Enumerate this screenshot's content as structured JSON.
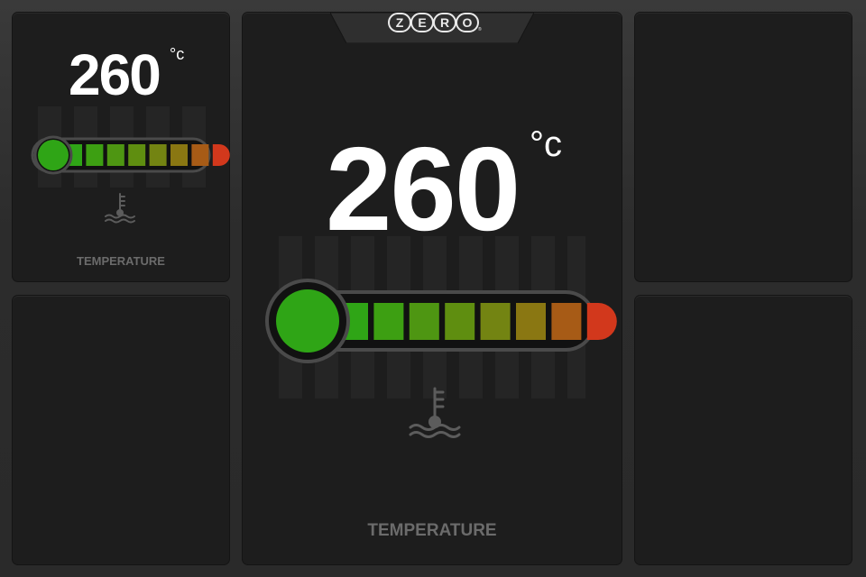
{
  "brand": {
    "letters": [
      "Z",
      "E",
      "R",
      "O"
    ],
    "mark": "®"
  },
  "gauges": {
    "small": {
      "value": "260",
      "unit": "°c",
      "label": "TEMPERATURE",
      "level": 1.0
    },
    "large": {
      "value": "260",
      "unit": "°c",
      "label": "TEMPERATURE",
      "level": 1.0
    }
  },
  "colors": {
    "segments": [
      "#2fa516",
      "#3d9f12",
      "#4e9612",
      "#5f8e10",
      "#738412",
      "#8a7712",
      "#a75b16",
      "#d2381c"
    ],
    "bulb": "#2fa516",
    "panel": "#1d1d1d",
    "label": "#6b6b6b"
  },
  "icons": {
    "temperature": "coolant-temperature-icon"
  }
}
